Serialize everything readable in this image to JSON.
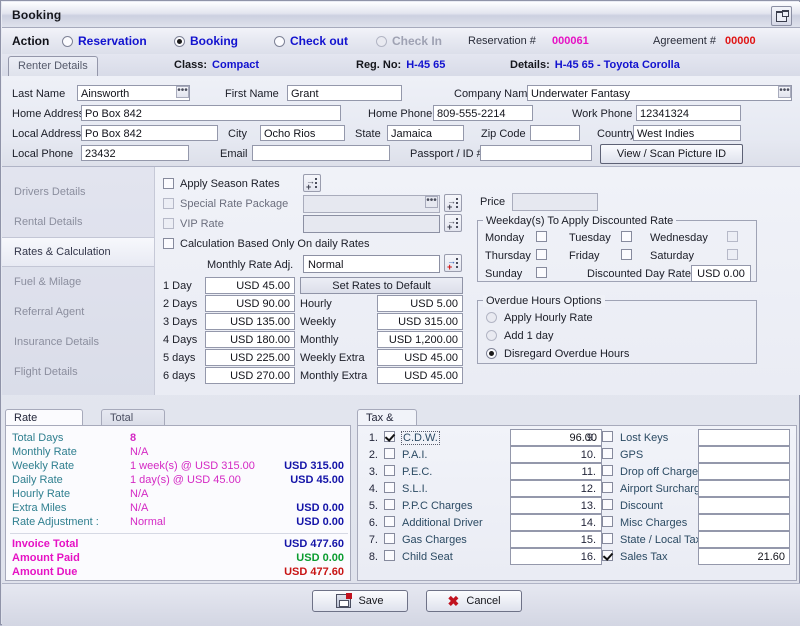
{
  "window": {
    "title": "Booking",
    "restore_icon": "restore-icon"
  },
  "action_bar": {
    "label": "Action",
    "options": [
      {
        "label": "Reservation",
        "selected": false,
        "disabled": false
      },
      {
        "label": "Booking",
        "selected": true,
        "disabled": false
      },
      {
        "label": "Check out",
        "selected": false,
        "disabled": false
      },
      {
        "label": "Check In",
        "selected": false,
        "disabled": true
      }
    ],
    "reservation_label": "Reservation #",
    "reservation_value": "000061",
    "reservation_color": "#e612c4",
    "agreement_label": "Agreement #",
    "agreement_value": "00000",
    "agreement_color": "#e01414"
  },
  "detail_bar": {
    "tab": "Renter Details",
    "class_label": "Class:",
    "class_value": "Compact",
    "reg_label": "Reg. No:",
    "reg_value": "H-45 65",
    "details_label": "Details:",
    "details_value": "H-45 65 - Toyota Corolla"
  },
  "renter_form": {
    "last_name": {
      "label": "Last Name",
      "value": "Ainsworth"
    },
    "first_name": {
      "label": "First Name",
      "value": "Grant"
    },
    "company_name": {
      "label": "Company Name",
      "value": "Underwater Fantasy"
    },
    "home_address": {
      "label": "Home Address",
      "value": "Po Box 842"
    },
    "home_phone": {
      "label": "Home Phone",
      "value": "809-555-2214"
    },
    "work_phone": {
      "label": "Work Phone",
      "value": "12341324"
    },
    "local_address": {
      "label": "Local Address",
      "value": "Po Box 842"
    },
    "city": {
      "label": "City",
      "value": "Ocho Rios"
    },
    "state": {
      "label": "State",
      "value": "Jamaica"
    },
    "zip": {
      "label": "Zip Code",
      "value": ""
    },
    "country": {
      "label": "Country",
      "value": "West Indies"
    },
    "local_phone": {
      "label": "Local Phone",
      "value": "23432"
    },
    "email": {
      "label": "Email",
      "value": ""
    },
    "passport": {
      "label": "Passport / ID #",
      "value": ""
    },
    "scan_button": "View / Scan Picture ID"
  },
  "sidebar": {
    "items": [
      {
        "label": "Drivers Details",
        "active": false
      },
      {
        "label": "Rental Details",
        "active": false
      },
      {
        "label": "Rates & Calculation",
        "active": true
      },
      {
        "label": "Fuel & Milage",
        "active": false
      },
      {
        "label": "Referral Agent",
        "active": false
      },
      {
        "label": "Insurance Details",
        "active": false
      },
      {
        "label": "Flight Details",
        "active": false
      }
    ]
  },
  "rates": {
    "apply_season_rates": {
      "label": "Apply Season Rates",
      "checked": false
    },
    "special_rate_package": {
      "label": "Special Rate Package",
      "checked": false,
      "value": ""
    },
    "vip_rate": {
      "label": "VIP Rate",
      "checked": false,
      "value": ""
    },
    "calc_daily_only": {
      "label": "Calculation Based Only On daily Rates",
      "checked": false
    },
    "monthly_rate_adj": {
      "label": "Monthly Rate Adj.",
      "value": "Normal"
    },
    "set_defaults_button": "Set Rates to Default",
    "day_rates": [
      {
        "label": "1 Day",
        "value": "USD 45.00"
      },
      {
        "label": "2 Days",
        "value": "USD 90.00"
      },
      {
        "label": "3 Days",
        "value": "USD 135.00"
      },
      {
        "label": "4 Days",
        "value": "USD 180.00"
      },
      {
        "label": "5 days",
        "value": "USD 225.00"
      },
      {
        "label": "6 days",
        "value": "USD 270.00"
      }
    ],
    "period_rates": [
      {
        "label": "Hourly",
        "value": "USD 5.00"
      },
      {
        "label": "Weekly",
        "value": "USD 315.00"
      },
      {
        "label": "Monthly",
        "value": "USD 1,200.00"
      },
      {
        "label": "Weekly Extra",
        "value": "USD 45.00"
      },
      {
        "label": "Monthly Extra",
        "value": "USD 45.00"
      }
    ]
  },
  "price": {
    "label": "Price",
    "value": ""
  },
  "weekday_discount": {
    "legend": "Weekday(s) To Apply Discounted Rate",
    "days": [
      {
        "label": "Monday",
        "checked": false
      },
      {
        "label": "Tuesday",
        "checked": false
      },
      {
        "label": "Wednesday",
        "checked": false
      },
      {
        "label": "Thursday",
        "checked": false
      },
      {
        "label": "Friday",
        "checked": false
      },
      {
        "label": "Saturday",
        "checked": false
      },
      {
        "label": "Sunday",
        "checked": false
      }
    ],
    "rate_label": "Discounted Day Rate",
    "rate_value": "USD 0.00"
  },
  "overdue": {
    "legend": "Overdue Hours Options",
    "options": [
      {
        "label": "Apply Hourly Rate",
        "selected": false
      },
      {
        "label": "Add 1 day",
        "selected": false
      },
      {
        "label": "Disregard Overdue Hours",
        "selected": true
      }
    ]
  },
  "calc_tabs": [
    {
      "label": "Rate Calculations",
      "selected": true
    },
    {
      "label": "Total Overview",
      "selected": false
    }
  ],
  "rate_calculations": {
    "rows": [
      {
        "key": "Total Days",
        "mid": "8",
        "amount": ""
      },
      {
        "key": "Monthly Rate",
        "mid": "N/A",
        "amount": ""
      },
      {
        "key": "Weekly Rate",
        "mid": "1 week(s) @ USD 315.00",
        "amount": "USD 315.00"
      },
      {
        "key": "Daily Rate",
        "mid": "1 day(s) @ USD 45.00",
        "amount": "USD 45.00"
      },
      {
        "key": "Hourly Rate",
        "mid": "N/A",
        "amount": ""
      },
      {
        "key": "Extra Miles",
        "mid": "N/A",
        "amount": "USD 0.00"
      },
      {
        "key": "Rate Adjustment :",
        "mid": "Normal",
        "amount": "USD 0.00"
      }
    ],
    "totals": [
      {
        "key": "Invoice Total",
        "amount": "USD 477.60",
        "color": "#1414a8"
      },
      {
        "key": "Amount Paid",
        "amount": "USD 0.00",
        "color": "#0a9c2f"
      },
      {
        "key": "Amount Due",
        "amount": "USD 477.60",
        "color": "#c81414"
      }
    ]
  },
  "tax_charges": {
    "tab": "Tax & Charges",
    "left": [
      {
        "num": "1.",
        "label": "C.D.W.",
        "checked": true,
        "value": "96.00",
        "focused": true
      },
      {
        "num": "2.",
        "label": "P.A.I.",
        "checked": false,
        "value": ""
      },
      {
        "num": "3.",
        "label": "P.E.C.",
        "checked": false,
        "value": ""
      },
      {
        "num": "4.",
        "label": "S.L.I.",
        "checked": false,
        "value": ""
      },
      {
        "num": "5.",
        "label": "P.P.C Charges",
        "checked": false,
        "value": ""
      },
      {
        "num": "6.",
        "label": "Additional Driver",
        "checked": false,
        "value": ""
      },
      {
        "num": "7.",
        "label": "Gas Charges",
        "checked": false,
        "value": ""
      },
      {
        "num": "8.",
        "label": "Child Seat",
        "checked": false,
        "value": ""
      }
    ],
    "right": [
      {
        "num": "9.",
        "label": "Lost Keys",
        "checked": false,
        "value": ""
      },
      {
        "num": "10.",
        "label": "GPS",
        "checked": false,
        "value": ""
      },
      {
        "num": "11.",
        "label": "Drop off Charges",
        "checked": false,
        "value": ""
      },
      {
        "num": "12.",
        "label": "Airport Surcharges",
        "checked": false,
        "value": ""
      },
      {
        "num": "13.",
        "label": "Discount",
        "checked": false,
        "value": ""
      },
      {
        "num": "14.",
        "label": "Misc Charges",
        "checked": false,
        "value": ""
      },
      {
        "num": "15.",
        "label": "State / Local Tax",
        "checked": false,
        "value": ""
      },
      {
        "num": "16.",
        "label": "Sales Tax",
        "checked": true,
        "value": "21.60"
      }
    ]
  },
  "footer": {
    "save_label": "Save",
    "cancel_label": "Cancel"
  }
}
